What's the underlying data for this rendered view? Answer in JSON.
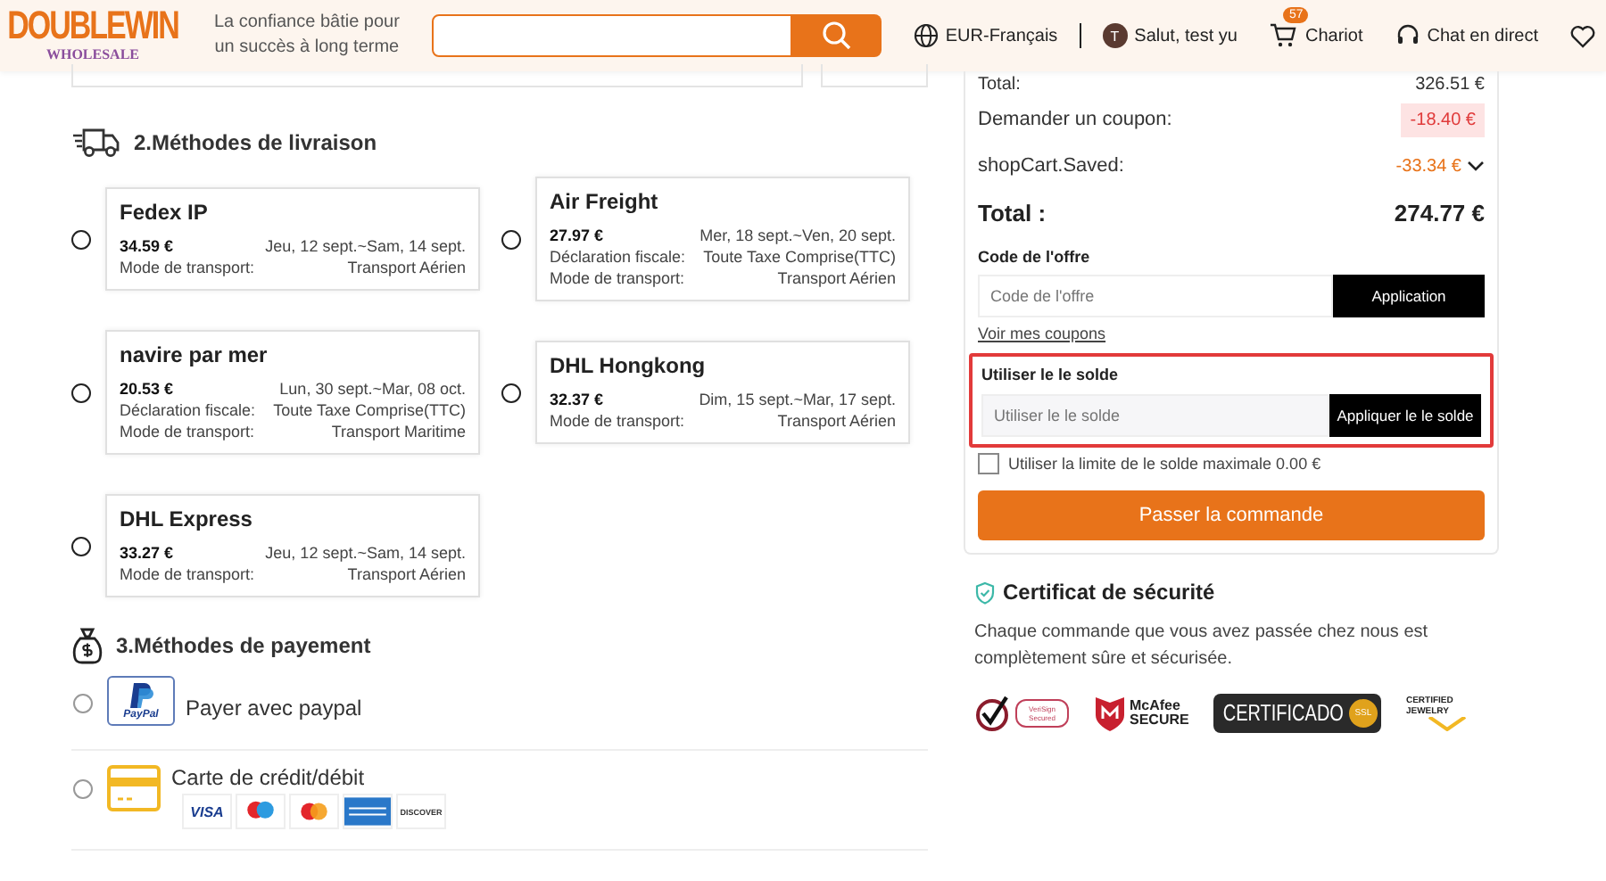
{
  "header": {
    "logo": "DOUBLEWIN",
    "logo_sub": "WHOLESALE",
    "tagline": "La confiance bâtie pour un succès à long terme",
    "language": "EUR-Français",
    "user_initial": "T",
    "greeting": "Salut, test yu",
    "cart_count": "57",
    "cart": "Chariot",
    "chat": "Chat en direct"
  },
  "delivery": {
    "title": "2.Méthodes de livraison",
    "columns": [
      [
        {
          "name": "Fedex IP",
          "price": "34.59 €",
          "dates": "Jeu, 12 sept.~Sam, 14 sept.",
          "mode_label": "Mode de transport:",
          "mode": "Transport Aérien",
          "selected": false
        },
        {
          "name": "navire par mer",
          "price": "20.53 €",
          "dates": "Lun, 30 sept.~Mar, 08 oct.",
          "tax_label": "Déclaration fiscale:",
          "tax": "Toute Taxe Comprise(TTC)",
          "mode_label": "Mode de transport:",
          "mode": "Transport Maritime",
          "selected": false
        },
        {
          "name": "DHL Express",
          "price": "33.27 €",
          "dates": "Jeu, 12 sept.~Sam, 14 sept.",
          "mode_label": "Mode de transport:",
          "mode": "Transport Aérien",
          "selected": false
        }
      ],
      [
        {
          "name": "Air Freight",
          "price": "27.97 €",
          "dates": "Mer, 18 sept.~Ven, 20 sept.",
          "tax_label": "Déclaration fiscale:",
          "tax": "Toute Taxe Comprise(TTC)",
          "mode_label": "Mode de transport:",
          "mode": "Transport Aérien",
          "selected": false
        },
        {
          "name": "DHL Hongkong",
          "price": "32.37 €",
          "dates": "Dim, 15 sept.~Mar, 17 sept.",
          "mode_label": "Mode de transport:",
          "mode": "Transport Aérien",
          "selected": false
        }
      ]
    ]
  },
  "payment": {
    "title": "3.Méthodes de payement",
    "methods": [
      {
        "kind": "paypal",
        "logo": "PayPal",
        "label": "Payer avec paypal",
        "selected": false
      },
      {
        "kind": "card",
        "label": "Carte de crédit/débit",
        "selected": false,
        "cards": [
          {
            "kind": "visa",
            "text": "VISA"
          },
          {
            "kind": "maestro"
          },
          {
            "kind": "mastercard"
          },
          {
            "kind": "amex"
          },
          {
            "kind": "discover",
            "text": "DISCOVER"
          }
        ]
      }
    ]
  },
  "summary": {
    "rows": [
      {
        "kind": "plain",
        "label": "Total:",
        "value": "326.51 €"
      },
      {
        "kind": "coupon",
        "label": "Demander un coupon:",
        "value": "-18.40 €"
      },
      {
        "kind": "saved",
        "label": "shopCart.Saved:",
        "value": "-33.34 €",
        "expanded": false
      }
    ],
    "total_label": "Total :",
    "total": "274.77 €",
    "offer": {
      "label": "Code de l'offre",
      "placeholder": "Code de l'offre",
      "button": "Application",
      "link": "Voir mes coupons"
    },
    "balance": {
      "label": "Utiliser le le solde",
      "placeholder": "Utiliser le le solde",
      "button": "Appliquer le le solde",
      "highlighted": true
    },
    "max_balance": {
      "label": "Utiliser la limite de le solde maximale 0.00 €",
      "checked": false
    },
    "order_button": "Passer la commande"
  },
  "security": {
    "title": "Certificat de sécurité",
    "text": "Chaque commande que vous avez passée chez nous est complètement sûre et sécurisée.",
    "badges": [
      {
        "kind": "verisign",
        "text": "VeriSign Secured"
      },
      {
        "kind": "mcafee",
        "text": "McAfee",
        "sub": "SECURE"
      },
      {
        "kind": "ssl",
        "text": "CERTIFICADO",
        "sub": "SSL"
      },
      {
        "kind": "jewelry",
        "text": "CERTIFIED JEWELRY"
      }
    ]
  }
}
